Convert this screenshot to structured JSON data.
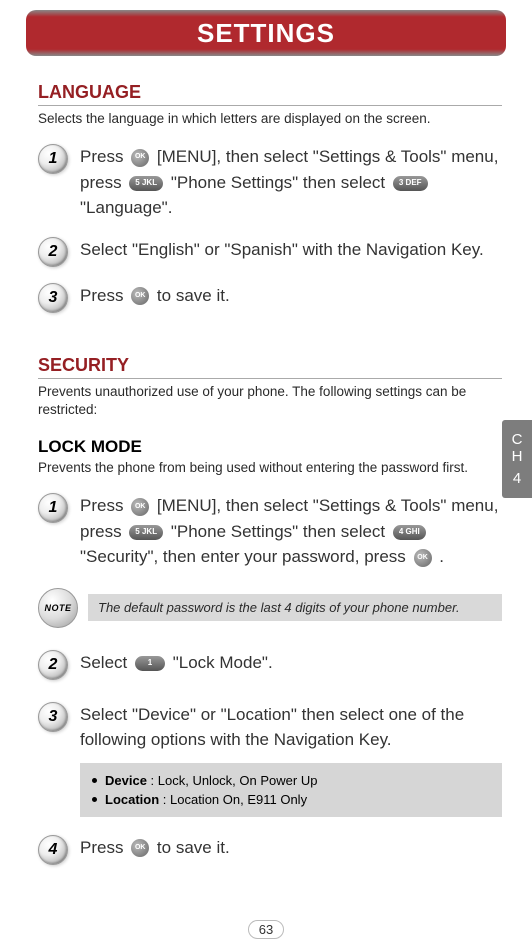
{
  "header": {
    "title": "SETTINGS"
  },
  "side_tab": {
    "line1": "C",
    "line2": "H",
    "line3": "4"
  },
  "page_number": "63",
  "icons": {
    "ok_label": "OK",
    "note_label": "NOTE",
    "key5": "5 JKL",
    "key3": "3 DEF",
    "key4": "4 GHI",
    "key1": "1"
  },
  "section_language": {
    "title": "LANGUAGE",
    "desc": "Selects the language in which letters are displayed on the screen.",
    "steps": [
      {
        "num": "1",
        "pre": "Press ",
        "seg1": " [MENU], then select \"Settings & Tools\" menu, press ",
        "seg2": " \"Phone Settings\" then select ",
        "seg3": " \"Language\"."
      },
      {
        "num": "2",
        "text": "Select \"English\" or \"Spanish\" with the Navigation Key."
      },
      {
        "num": "3",
        "pre": "Press ",
        "post": " to save it."
      }
    ]
  },
  "section_security": {
    "title": "SECURITY",
    "desc": "Prevents unauthorized use of your phone. The following settings can be restricted:"
  },
  "section_lockmode": {
    "title": "LOCK MODE",
    "desc": "Prevents the phone from being used without entering the password first.",
    "steps": [
      {
        "num": "1",
        "pre": "Press ",
        "seg1": " [MENU], then select \"Settings & Tools\" menu, press ",
        "seg2": " \"Phone Settings\" then select ",
        "seg3": " \"Security\", then enter your password, press ",
        "seg4": " ."
      },
      {
        "num": "2",
        "pre": "Select ",
        "post": " \"Lock Mode\"."
      },
      {
        "num": "3",
        "text": "Select \"Device\" or \"Location\" then select one of the following options with the Navigation Key."
      },
      {
        "num": "4",
        "pre": "Press ",
        "post": " to save it."
      }
    ],
    "note": "The default password is the last 4 digits of your phone number.",
    "options": {
      "device_label": "Device",
      "device_values": " : Lock, Unlock, On Power Up",
      "location_label": "Location",
      "location_values": " : Location On, E911 Only"
    }
  }
}
